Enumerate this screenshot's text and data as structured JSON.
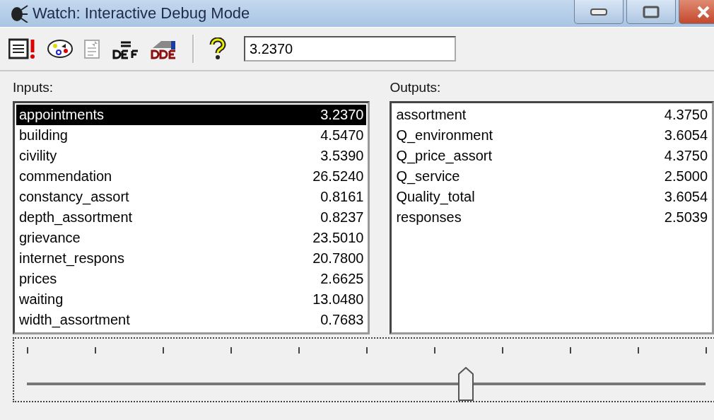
{
  "window": {
    "title": "Watch: Interactive Debug Mode"
  },
  "toolbar": {
    "value": "3.2370"
  },
  "inputs": {
    "label": "Inputs:",
    "items": [
      {
        "name": "appointments",
        "value": "3.2370",
        "selected": true
      },
      {
        "name": "building",
        "value": "4.5470",
        "selected": false
      },
      {
        "name": "civility",
        "value": "3.5390",
        "selected": false
      },
      {
        "name": "commendation",
        "value": "26.5240",
        "selected": false
      },
      {
        "name": "constancy_assort",
        "value": "0.8161",
        "selected": false
      },
      {
        "name": "depth_assortment",
        "value": "0.8237",
        "selected": false
      },
      {
        "name": "grievance",
        "value": "23.5010",
        "selected": false
      },
      {
        "name": "internet_respons",
        "value": "20.7800",
        "selected": false
      },
      {
        "name": "prices",
        "value": "2.6625",
        "selected": false
      },
      {
        "name": "waiting",
        "value": "13.0480",
        "selected": false
      },
      {
        "name": "width_assortment",
        "value": "0.7683",
        "selected": false
      }
    ]
  },
  "outputs": {
    "label": "Outputs:",
    "items": [
      {
        "name": "assortment",
        "value": "4.3750",
        "selected": false
      },
      {
        "name": "Q_environment",
        "value": "3.6054",
        "selected": false
      },
      {
        "name": "Q_price_assort",
        "value": "4.3750",
        "selected": false
      },
      {
        "name": "Q_service",
        "value": "2.5000",
        "selected": false
      },
      {
        "name": "Quality_total",
        "value": "3.6054",
        "selected": false
      },
      {
        "name": "responses",
        "value": "2.5039",
        "selected": false
      }
    ]
  },
  "slider": {
    "level": 0.647
  }
}
